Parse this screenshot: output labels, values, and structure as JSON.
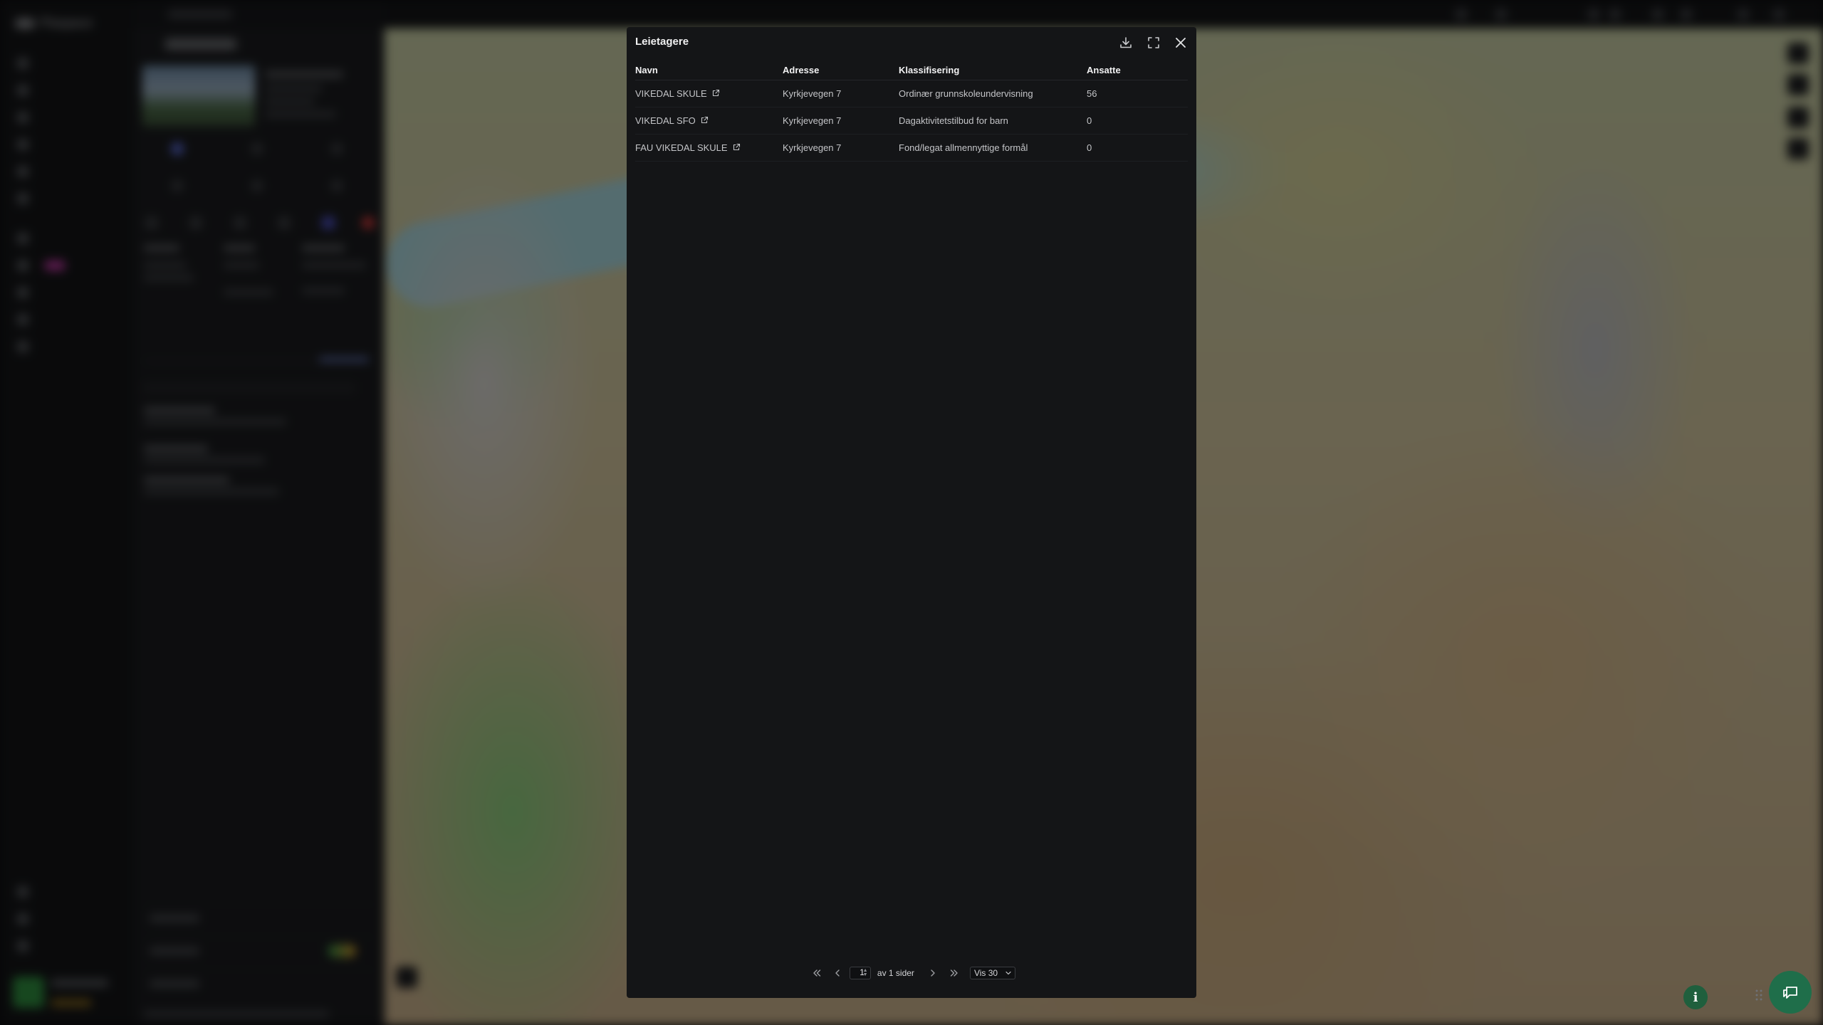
{
  "modal": {
    "title": "Leietagere",
    "actions": {
      "download_icon": "download-icon",
      "expand_icon": "expand-icon",
      "close_icon": "close-icon"
    },
    "table": {
      "headers": [
        "Navn",
        "Adresse",
        "Klassifisering",
        "Ansatte"
      ],
      "rows": [
        {
          "navn": "VIKEDAL SKULE",
          "adresse": "Kyrkjevegen 7",
          "klassifisering": "Ordinær grunnskoleundervisning",
          "ansatte": "56"
        },
        {
          "navn": "VIKEDAL SFO",
          "adresse": "Kyrkjevegen 7",
          "klassifisering": "Dagaktivitetstilbud for barn",
          "ansatte": "0"
        },
        {
          "navn": "FAU VIKEDAL SKULE",
          "adresse": "Kyrkjevegen 7",
          "klassifisering": "Fond/legat allmennyttige formål",
          "ansatte": "0"
        }
      ]
    },
    "pagination": {
      "page": "1",
      "of_label": "av 1 sider",
      "per_page_label": "Vis 30"
    }
  },
  "background": {
    "brand": "Plaspace"
  },
  "colors": {
    "modal_bg": "#141517",
    "accent_green": "#1f6e4a"
  }
}
